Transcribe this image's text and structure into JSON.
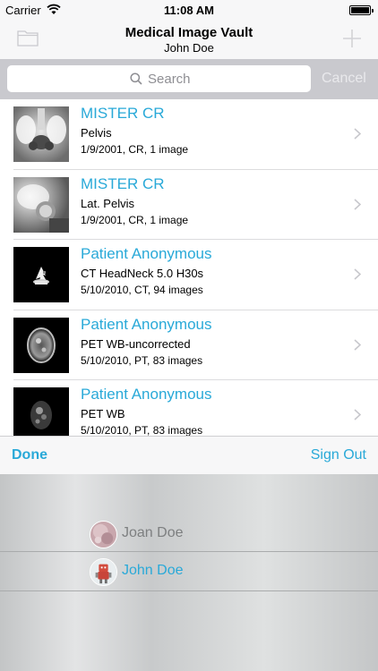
{
  "status_bar": {
    "carrier": "Carrier",
    "time": "11:08 AM"
  },
  "nav": {
    "title": "Medical Image Vault",
    "subtitle": "John Doe"
  },
  "search": {
    "placeholder": "Search",
    "cancel_label": "Cancel"
  },
  "studies": [
    {
      "patient": "MISTER CR",
      "description": "Pelvis",
      "meta": "1/9/2001, CR, 1 image"
    },
    {
      "patient": "MISTER CR",
      "description": "Lat. Pelvis",
      "meta": "1/9/2001, CR, 1 image"
    },
    {
      "patient": "Patient Anonymous",
      "description": "CT HeadNeck  5.0  H30s",
      "meta": "5/10/2010, CT, 94 images"
    },
    {
      "patient": "Patient Anonymous",
      "description": "PET WB-uncorrected",
      "meta": "5/10/2010, PT, 83 images"
    },
    {
      "patient": "Patient Anonymous",
      "description": "PET WB",
      "meta": "5/10/2010, PT, 83 images"
    }
  ],
  "toolbar": {
    "done_label": "Done",
    "signout_label": "Sign Out"
  },
  "accounts": [
    {
      "name": "Joan Doe",
      "active": false
    },
    {
      "name": "John Doe",
      "active": true
    }
  ],
  "colors": {
    "accent": "#29a9d8",
    "search_bar_bg": "#c9c9ce",
    "chrome_bg": "#f7f7f8"
  }
}
